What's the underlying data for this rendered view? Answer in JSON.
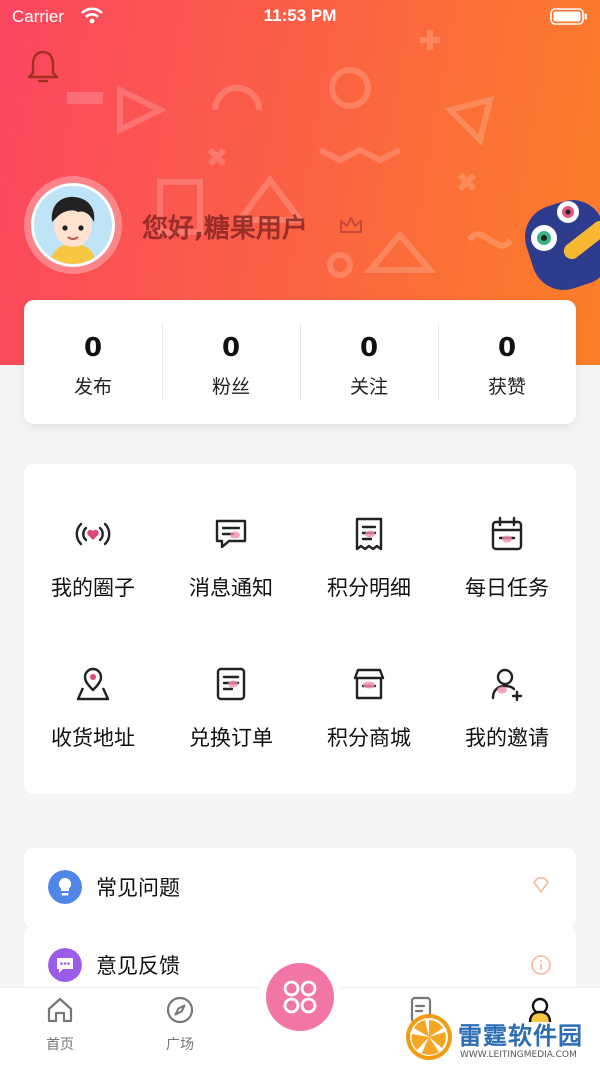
{
  "status_bar": {
    "carrier": "Carrier",
    "time": "11:53 PM"
  },
  "profile": {
    "greeting": "您好,糖果用户"
  },
  "stats": [
    {
      "value": "0",
      "label": "发布"
    },
    {
      "value": "0",
      "label": "粉丝"
    },
    {
      "value": "0",
      "label": "关注"
    },
    {
      "value": "0",
      "label": "获赞"
    }
  ],
  "grid": [
    {
      "label": "我的圈子",
      "icon": "circle-signal-icon"
    },
    {
      "label": "消息通知",
      "icon": "message-icon"
    },
    {
      "label": "积分明细",
      "icon": "receipt-icon"
    },
    {
      "label": "每日任务",
      "icon": "calendar-icon"
    },
    {
      "label": "收货地址",
      "icon": "location-icon"
    },
    {
      "label": "兑换订单",
      "icon": "order-list-icon"
    },
    {
      "label": "积分商城",
      "icon": "store-icon"
    },
    {
      "label": "我的邀请",
      "icon": "invite-user-icon"
    }
  ],
  "list": [
    {
      "label": "常见问题",
      "icon": "bulb-icon"
    },
    {
      "label": "意见反馈",
      "icon": "feedback-icon"
    }
  ],
  "tabbar": [
    {
      "label": "首页",
      "icon": "home-icon"
    },
    {
      "label": "广场",
      "icon": "compass-icon"
    },
    {
      "label": "",
      "icon": "document-icon"
    },
    {
      "label": "",
      "icon": "user-icon"
    }
  ],
  "watermark": {
    "title": "雷霆软件园",
    "subtitle": "WWW.LEITINGMEDIA.COM"
  },
  "colors": {
    "gradient_start": "#fb4660",
    "gradient_end": "#fb7f27",
    "accent_pink": "#f276a5"
  }
}
